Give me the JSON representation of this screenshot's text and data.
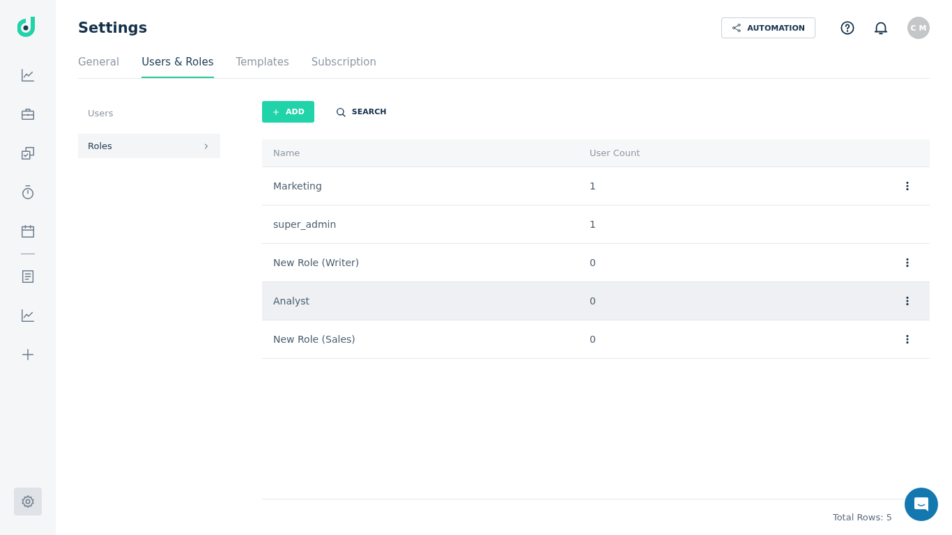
{
  "sidebar": {
    "groups": [
      {
        "items": [
          {
            "kind": "chart",
            "selected": false
          },
          {
            "kind": "briefcase",
            "selected": false
          },
          {
            "kind": "tasks",
            "selected": false
          },
          {
            "kind": "timer",
            "selected": false
          },
          {
            "kind": "calendar",
            "selected": false
          }
        ]
      },
      {
        "items": [
          {
            "kind": "document",
            "selected": false
          },
          {
            "kind": "chart",
            "selected": false
          },
          {
            "kind": "plus",
            "selected": false
          }
        ]
      }
    ],
    "settings": {
      "selected": true
    }
  },
  "header": {
    "title": "Settings",
    "automation_button": "AUTOMATION",
    "avatar": "C M"
  },
  "tabs": [
    {
      "label": "General",
      "selected": false
    },
    {
      "label": "Users & Roles",
      "selected": true
    },
    {
      "label": "Templates",
      "selected": false
    },
    {
      "label": "Subscription",
      "selected": false
    }
  ],
  "submenu": [
    {
      "label": "Users",
      "selected": false
    },
    {
      "label": "Roles",
      "selected": true
    }
  ],
  "toolbar": {
    "add_button": "ADD",
    "search_button": "SEARCH"
  },
  "table": {
    "columns": [
      "Name",
      "User Count"
    ],
    "rows": [
      {
        "name": "Marketing",
        "count": "1",
        "has_menu": true,
        "highlighted": false
      },
      {
        "name": "super_admin",
        "count": "1",
        "has_menu": false,
        "highlighted": false
      },
      {
        "name": "New Role (Writer)",
        "count": "0",
        "has_menu": true,
        "highlighted": false
      },
      {
        "name": "Analyst",
        "count": "0",
        "has_menu": true,
        "highlighted": true
      },
      {
        "name": "New Role (Sales)",
        "count": "0",
        "has_menu": true,
        "highlighted": false
      }
    ]
  },
  "footer": {
    "total_rows": "Total Rows: 5"
  }
}
